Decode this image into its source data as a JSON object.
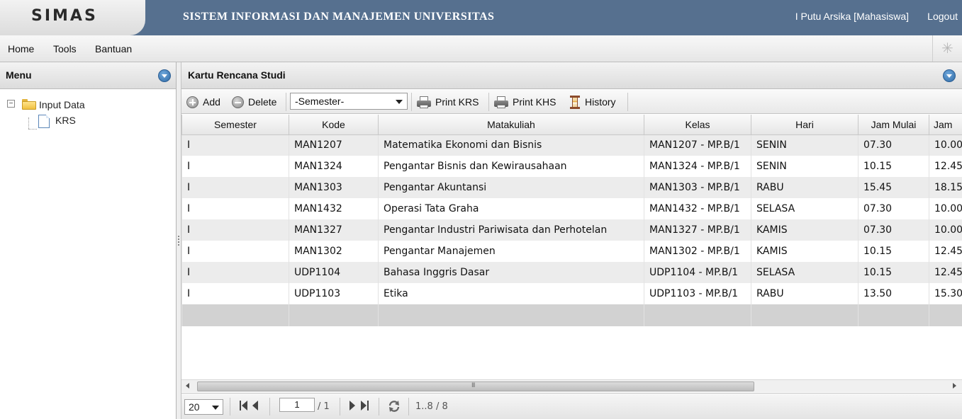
{
  "header": {
    "logo": "SIMAS",
    "title": "SISTEM INFORMASI DAN MANAJEMEN UNIVERSITAS",
    "user": "I Putu Arsika [Mahasiswa]",
    "logout": "Logout"
  },
  "menubar": {
    "items": [
      "Home",
      "Tools",
      "Bantuan"
    ]
  },
  "side": {
    "title": "Menu",
    "tree": {
      "folder": "Input Data",
      "child": "KRS"
    }
  },
  "main": {
    "title": "Kartu Rencana Studi",
    "toolbar": {
      "add": "Add",
      "delete": "Delete",
      "semester_select": "-Semester-",
      "print_krs": "Print KRS",
      "print_khs": "Print KHS",
      "history": "History"
    },
    "columns": [
      "Semester",
      "Kode",
      "Matakuliah",
      "Kelas",
      "Hari",
      "Jam Mulai",
      "Jam"
    ],
    "rows": [
      [
        "I",
        "MAN1207",
        "Matematika Ekonomi dan Bisnis",
        "MAN1207 - MP.B/1",
        "SENIN",
        "07.30",
        "10.00"
      ],
      [
        "I",
        "MAN1324",
        "Pengantar Bisnis dan Kewirausahaan",
        "MAN1324 - MP.B/1",
        "SENIN",
        "10.15",
        "12.45"
      ],
      [
        "I",
        "MAN1303",
        "Pengantar Akuntansi",
        "MAN1303 - MP.B/1",
        "RABU",
        "15.45",
        "18.15"
      ],
      [
        "I",
        "MAN1432",
        "Operasi Tata Graha",
        "MAN1432 - MP.B/1",
        "SELASA",
        "07.30",
        "10.00"
      ],
      [
        "I",
        "MAN1327",
        "Pengantar Industri Pariwisata dan Perhotelan",
        "MAN1327 - MP.B/1",
        "KAMIS",
        "07.30",
        "10.00"
      ],
      [
        "I",
        "MAN1302",
        "Pengantar Manajemen",
        "MAN1302 - MP.B/1",
        "KAMIS",
        "10.15",
        "12.45"
      ],
      [
        "I",
        "UDP1104",
        "Bahasa Inggris Dasar",
        "UDP1104 - MP.B/1",
        "SELASA",
        "10.15",
        "12.45"
      ],
      [
        "I",
        "UDP1103",
        "Etika",
        "UDP1103 - MP.B/1",
        "RABU",
        "13.50",
        "15.30"
      ]
    ],
    "pager": {
      "page_size": "20",
      "page_current": "1",
      "page_total": "/ 1",
      "info": "1..8 / 8"
    }
  },
  "colors": {
    "header_bg": "#56708f",
    "accent_blue": "#2f6aa5"
  },
  "icons": [
    "expander-minus-icon",
    "folder-icon",
    "file-icon",
    "collapse-icon",
    "add-icon",
    "delete-icon",
    "printer-icon",
    "hourglass-icon",
    "first-page-icon",
    "prev-page-icon",
    "next-page-icon",
    "last-page-icon",
    "refresh-icon",
    "spinner-icon"
  ]
}
